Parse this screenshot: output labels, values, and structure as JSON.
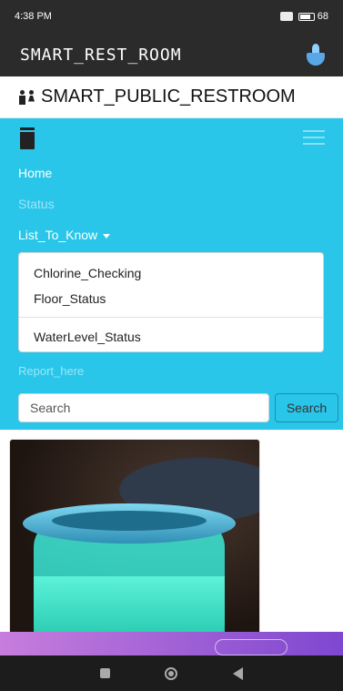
{
  "status_bar": {
    "time": "4:38 PM",
    "battery": "68"
  },
  "app_bar": {
    "title": "SMART_REST_ROOM"
  },
  "site_header": {
    "title": "SMART_PUBLIC_RESTROOM"
  },
  "nav": {
    "home": "Home",
    "status": "Status",
    "list_to_know": "List_To_Know",
    "dropdown": {
      "item1": "Chlorine_Checking",
      "item2": "Floor_Status",
      "item3": "WaterLevel_Status"
    },
    "report": "Report_here",
    "search": {
      "placeholder": "Search",
      "button": "Search"
    }
  },
  "colors": {
    "accent": "#29c6ea",
    "appbar": "#2b2b2b"
  },
  "icons": [
    "restroom-people-icon",
    "fountain-logo-icon",
    "brand-door-icon",
    "hamburger-menu-icon"
  ]
}
